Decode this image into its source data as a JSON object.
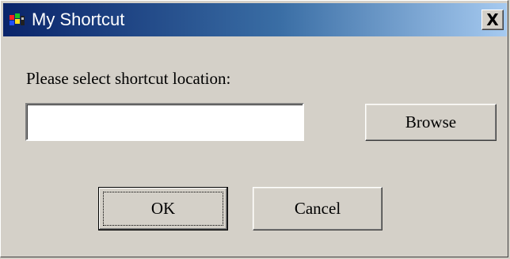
{
  "window": {
    "title": "My Shortcut",
    "close_glyph": "X",
    "title_icon": "app-icon"
  },
  "form": {
    "prompt": "Please select shortcut location:",
    "location_value": "",
    "location_placeholder": ""
  },
  "buttons": {
    "browse_label": "Browse",
    "ok_label": "OK",
    "cancel_label": "Cancel"
  },
  "colors": {
    "title_gradient_start": "#0a246a",
    "title_gradient_end": "#a6caf0",
    "dialog_face": "#d4d0c8"
  }
}
